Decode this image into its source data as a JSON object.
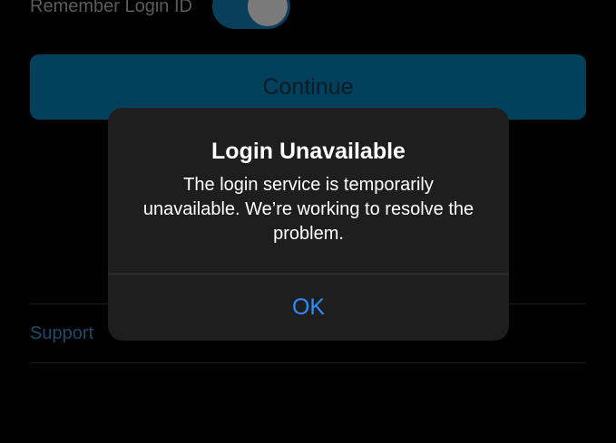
{
  "background": {
    "remember_login_id": {
      "label": "Remember Login ID",
      "enabled": true
    },
    "continue_label": "Continue",
    "support_label": "Support"
  },
  "alert": {
    "title": "Login Unavailable",
    "message": "The login service is temporarily unavailable. We’re working to resolve the problem.",
    "ok_label": "OK"
  },
  "colors": {
    "accent_blue": "#2f8cff",
    "continue_button": "#00405c",
    "alert_background": "#1e1e1e",
    "screen_background": "#000000"
  }
}
